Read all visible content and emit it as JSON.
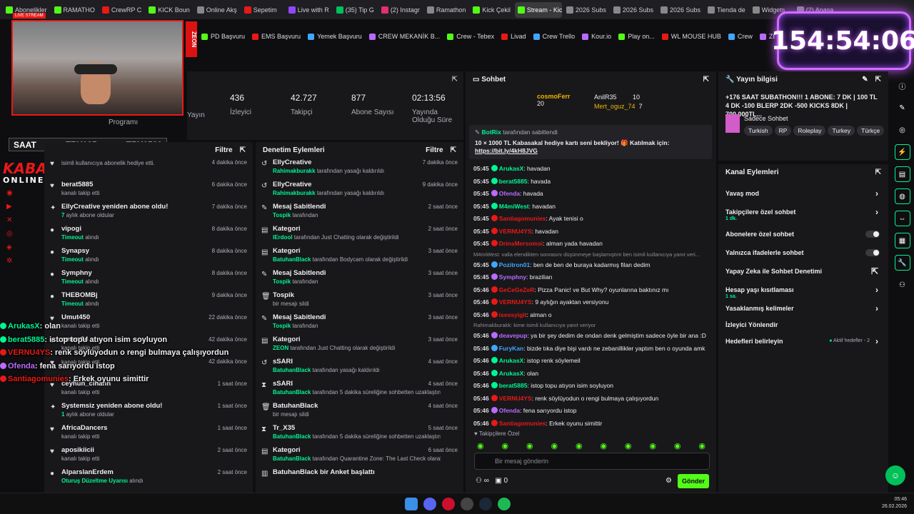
{
  "tabs": [
    {
      "label": "Abonelikler",
      "color": "#53fc18"
    },
    {
      "label": "RAMATHO",
      "color": "#53fc18"
    },
    {
      "label": "CrewRP C",
      "color": "#e91916"
    },
    {
      "label": "KICK Boun",
      "color": "#53fc18"
    },
    {
      "label": "Online Akş",
      "color": "#888"
    },
    {
      "label": "Sepetim",
      "color": "#e91916"
    },
    {
      "label": "Live with R",
      "color": "#9146ff"
    },
    {
      "label": "(35) Tip G",
      "color": "#00c05a"
    },
    {
      "label": "(2) Instagr",
      "color": "#e1306c"
    },
    {
      "label": "Ramathon",
      "color": "#888"
    },
    {
      "label": "Kick Çekil",
      "color": "#53fc18"
    },
    {
      "label": "Stream - Kick Dash",
      "color": "#53fc18",
      "active": true
    },
    {
      "label": "2026 Subs",
      "color": "#888"
    },
    {
      "label": "2026 Subs",
      "color": "#888"
    },
    {
      "label": "2026 Subs",
      "color": "#888"
    },
    {
      "label": "Tienda de",
      "color": "#888"
    },
    {
      "label": "Widgets",
      "color": "#888"
    },
    {
      "label": "(2) Anasa",
      "color": "#888"
    }
  ],
  "bookmarks": [
    "PD Başvuru",
    "EMS Başvuru",
    "Yemek Başvuru",
    "CREW MEKANİK B...",
    "Crew - Tebex",
    "Livad",
    "Crew Trello",
    "Kour.io",
    "Play on...",
    "WL MOUSE HUB",
    "Crew",
    "ZEON Stats | Aero...",
    "APIq"
  ],
  "timer": "154:54:06",
  "webcam": {
    "live_label": "LIVE STREAM",
    "brand": "ZEON"
  },
  "saat": {
    "label": "SAAT",
    "v1": "TRY125",
    "v2": "TRY1500"
  },
  "kabasakal": {
    "line1": "KABASAKAL",
    "line2": "ONLINE.COM"
  },
  "stats": [
    {
      "value": "",
      "label": "Yayın"
    },
    {
      "value": "436",
      "label": "İzleyici"
    },
    {
      "value": "42.727",
      "label": "Takipçi"
    },
    {
      "value": "877",
      "label": "Abone Sayısı"
    },
    {
      "value": "02:13:56",
      "label": "Yayında Olduğu Süre"
    }
  ],
  "stats_program": "Programı",
  "activity": {
    "filter": "Filtre",
    "rows": [
      {
        "icon": "♥",
        "title": "",
        "sub": "isimli kullanıcıya abonelik hediye etti.",
        "time": "4 dakika önce"
      },
      {
        "icon": "♥",
        "title": "berat5885",
        "sub": "kanalı takip etti",
        "time": "6 dakika önce"
      },
      {
        "icon": "✦",
        "title": "EllyCreative yeniden abone oldu!",
        "sub": "aylık abone oldular",
        "subg": "7",
        "time": "7 dakika önce"
      },
      {
        "icon": "●",
        "title": "vipogi",
        "sub": "alındı",
        "subg": "Timeout",
        "time": "8 dakika önce"
      },
      {
        "icon": "●",
        "title": "Synapsy",
        "sub": "alındı",
        "subg": "Timeout",
        "time": "8 dakika önce"
      },
      {
        "icon": "●",
        "title": "Symphny",
        "sub": "alındı",
        "subg": "Timeout",
        "time": "8 dakika önce"
      },
      {
        "icon": "●",
        "title": "THEBOMBj",
        "sub": "alındı",
        "subg": "Timeout",
        "time": "9 dakika önce"
      },
      {
        "icon": "♥",
        "title": "Umut450",
        "sub": "kanalı takip etti",
        "time": "22 dakika önce"
      },
      {
        "icon": "♥",
        "title": "omerr34",
        "sub": "kanalı takip etti",
        "time": "42 dakika önce"
      },
      {
        "icon": "♥",
        "title": "",
        "sub": "kanalı takip etti",
        "time": "42 dakika önce"
      },
      {
        "icon": "♥",
        "title": "ceyhun_cihann",
        "sub": "kanalı takip etti",
        "time": "1 saat önce"
      },
      {
        "icon": "✦",
        "title": "Systemsiz yeniden abone oldu!",
        "sub": "aylık abone oldular",
        "subg": "1",
        "time": "1 saat önce"
      },
      {
        "icon": "♥",
        "title": "AfricaDancers",
        "sub": "kanalı takip etti",
        "time": "1 saat önce"
      },
      {
        "icon": "♥",
        "title": "aposikiicii",
        "sub": "kanalı takip etti",
        "time": "2 saat önce"
      },
      {
        "icon": "●",
        "title": "AlparslanErdem",
        "sub": "alındı",
        "subg": "Oturuş Düzeltme Uyarısı",
        "time": "2 saat önce"
      }
    ]
  },
  "moderation": {
    "title": "Denetim Eylemleri",
    "filter": "Filtre",
    "rows": [
      {
        "icon": "↺",
        "title": "EllyCreative",
        "g": "Rahimakburakk",
        "sub": "tarafından yasağı kaldırıldı",
        "time": "7 dakika önce"
      },
      {
        "icon": "↺",
        "title": "EllyCreative",
        "g": "Rahimakburakk",
        "sub": "tarafından yasağı kaldırıldı",
        "time": "9 dakika önce"
      },
      {
        "icon": "✎",
        "title": "Mesaj Sabitlendi",
        "g": "Tospik",
        "sub": "tarafından",
        "time": "2 saat önce"
      },
      {
        "icon": "▤",
        "title": "Kategori",
        "g": "lErdool",
        "sub": "tarafından Just Chatting olarak değiştirildi",
        "time": "2 saat önce"
      },
      {
        "icon": "▤",
        "title": "Kategori",
        "g": "BatuhanBlack",
        "sub": "tarafından Bodycam olarak değiştirildi",
        "time": "3 saat önce"
      },
      {
        "icon": "✎",
        "title": "Mesaj Sabitlendi",
        "g": "Tospik",
        "sub": "tarafından",
        "time": "3 saat önce"
      },
      {
        "icon": "🗑",
        "title": "Tospik",
        "g": "",
        "sub": "bir mesajı sildi",
        "time": "3 saat önce"
      },
      {
        "icon": "✎",
        "title": "Mesaj Sabitlendi",
        "g": "Tospik",
        "sub": "tarafından",
        "time": "3 saat önce"
      },
      {
        "icon": "▤",
        "title": "Kategori",
        "g": "ZEON",
        "sub": "tarafından Just Chatting olarak değiştirildi",
        "time": "3 saat önce"
      },
      {
        "icon": "↺",
        "title": "sSARI",
        "g": "BatuhanBlack",
        "sub": "tarafından yasağı kaldırıldı",
        "time": "4 saat önce"
      },
      {
        "icon": "⧗",
        "title": "sSARI",
        "g": "BatuhanBlack",
        "sub": "tarafından 5 dakika süreliğine sohbetten uzaklaştırıldı",
        "time": "4 saat önce"
      },
      {
        "icon": "🗑",
        "title": "BatuhanBlack",
        "g": "",
        "sub": "bir mesajı sildi",
        "time": "4 saat önce"
      },
      {
        "icon": "⧗",
        "title": "Tr_X35",
        "g": "BatuhanBlack",
        "sub": "tarafından 5 dakika süreliğine sohbetten uzaklaştırıldı",
        "time": "5 saat önce"
      },
      {
        "icon": "▤",
        "title": "Kategori",
        "g": "BatuhanBlack",
        "sub": "tarafından Quarantine Zone: The Last Check olarak",
        "time": "6 saat önce"
      },
      {
        "icon": "▥",
        "title": "BatuhanBlack bir Anket başlattı",
        "g": "",
        "sub": "",
        "time": ""
      }
    ]
  },
  "chat": {
    "title": "Sohbet",
    "top1": {
      "name": "cosmoFerr",
      "count": "20"
    },
    "top2": {
      "name": "AnilR35",
      "count": "10"
    },
    "top3": {
      "name": "Mert_oguz_74",
      "count": "7"
    },
    "pinned": {
      "by": "BotRix",
      "by_suffix": "tarafından sabitlendi",
      "text": "10 × 1000 TL Kabasakal hediye kartı seni bekliyor! 🎁 Katılmak için:",
      "link": "https://bit.ly/4kH8JVG"
    },
    "messages": [
      {
        "time": "05:45",
        "user": "ArukasX",
        "color": "#00f593",
        "text": "havadan"
      },
      {
        "time": "05:45",
        "user": "berat5885",
        "color": "#00f593",
        "text": "havada"
      },
      {
        "time": "05:45",
        "user": "Ofenda",
        "color": "#b86bff",
        "text": "havada"
      },
      {
        "time": "05:45",
        "user": "M4miWest",
        "color": "#00f593",
        "text": "havadan"
      },
      {
        "time": "05:45",
        "user": "Santiagomunies",
        "color": "#e91916",
        "text": "Ayak tenisi o"
      },
      {
        "time": "05:45",
        "user": "VERNU4YS",
        "color": "#e91916",
        "text": "havadan"
      },
      {
        "time": "05:45",
        "user": "DrinsMersomsi",
        "color": "#e91916",
        "text": "alman yada havadan"
      },
      {
        "reply": "M4miWest: valla elendikten sonrasını düşünmeye başlamıştım ben isimli kullanıcıya yanıt veri..."
      },
      {
        "time": "05:45",
        "user": "Pozitron01",
        "color": "#3fa7ff",
        "text": "ben de ben de buraya kadarmış filan dedim"
      },
      {
        "time": "05:45",
        "user": "Symphny",
        "color": "#b86bff",
        "text": "brazilian"
      },
      {
        "time": "05:46",
        "user": "GeCeGeZeR",
        "color": "#e91916",
        "text": "Pizza Panic! ve But Why? oyunlarına baktınız mı"
      },
      {
        "time": "05:46",
        "user": "VERNU4YS",
        "color": "#e91916",
        "text": "9 aylığın ayaktan versiyonu"
      },
      {
        "time": "05:46",
        "user": "isessyigit",
        "color": "#e91916",
        "text": "alman o"
      },
      {
        "reply": "Rahimakburakk: kime isimli kullanıcıya yanıt veriyor"
      },
      {
        "time": "05:46",
        "user": "deavepup",
        "color": "#b86bff",
        "text": "ya bir şey dedim de ondan denk gelmiştim sadece öyle bir ana :D"
      },
      {
        "time": "05:46",
        "user": "FuryKan",
        "color": "#3fa7ff",
        "text": "bizde tıka diye bişi vardı ne zebanillikler yaptım ben o oyunda amk"
      },
      {
        "time": "05:46",
        "user": "ArukasX",
        "color": "#00f593",
        "text": "istop renk söylemeil"
      },
      {
        "time": "05:46",
        "user": "ArukasX",
        "color": "#00f593",
        "text": "olan"
      },
      {
        "time": "05:46",
        "user": "berat5885",
        "color": "#00f593",
        "text": "istop topu atıyon isim soyluyon"
      },
      {
        "time": "05:46",
        "user": "VERNU4YS",
        "color": "#e91916",
        "text": "renk söylüyodun o rengi bulmaya çalışıyordun"
      },
      {
        "time": "05:46",
        "user": "Ofenda",
        "color": "#b86bff",
        "text": "fena sarıyordu istop"
      },
      {
        "time": "05:46",
        "user": "Santiagomunies",
        "color": "#e91916",
        "text": "Erkek oyunu simittir"
      }
    ],
    "followers_only": "Takipçilere Özel",
    "input_placeholder": "Bir mesaj gönderin",
    "send_label": "Gönder",
    "count_a": "∞",
    "count_b": "0"
  },
  "info": {
    "title": "Yayın bilgisi",
    "desc": "+176 SAAT SUBATHON!!! 1 ABONE: 7 DK | 100 TL 4 DK -100 BLERP 2DK -500 KICKS 8DK | 700.000TL...",
    "category": "Sadece Sohbet",
    "tags": [
      "Turkish",
      "RP",
      "Roleplay",
      "Turkey",
      "Türkçe"
    ]
  },
  "actions": {
    "title": "Kanal Eylemleri",
    "items": [
      {
        "label": "Yavaş mod",
        "sub": "",
        "type": "chev"
      },
      {
        "label": "Takipçilere özel sohbet",
        "sub": "1 dk.",
        "type": "chev"
      },
      {
        "label": "Abonelere özel sohbet",
        "sub": "",
        "type": "toggle"
      },
      {
        "label": "Yalnızca ifadelerle sohbet",
        "sub": "",
        "type": "toggle"
      },
      {
        "label": "Yapay Zeka ile Sohbet Denetimi",
        "sub": "",
        "type": "link"
      },
      {
        "label": "Hesap yaşı kısıtlaması",
        "sub": "1 sa.",
        "type": "chev"
      },
      {
        "label": "Yasaklanmış kelimeler",
        "sub": "",
        "type": "chev"
      },
      {
        "label": "İzleyici Yönlendir",
        "sub": "",
        "type": "none"
      },
      {
        "label": "Hedefleri belirleyin",
        "sub": "",
        "type": "goal",
        "extra": "Aktif hedefler - 2"
      }
    ]
  },
  "overlay_chat": [
    {
      "user": "ArukasX",
      "color": "#00f593",
      "text": "olan"
    },
    {
      "user": "berat5885",
      "color": "#00f593",
      "text": "istop topu atıyon isim soyluyon"
    },
    {
      "user": "VERNU4YS",
      "color": "#e91916",
      "text": "renk söylüyodun o rengi bulmaya çalışıyordun"
    },
    {
      "user": "Ofenda",
      "color": "#b86bff",
      "text": "fena sarıyordu istop"
    },
    {
      "user": "Santiagomunies",
      "color": "#e91916",
      "text": "Erkek oyunu simittir"
    }
  ],
  "taskbar": {
    "time": "05:46",
    "date": "26.02.2026"
  }
}
